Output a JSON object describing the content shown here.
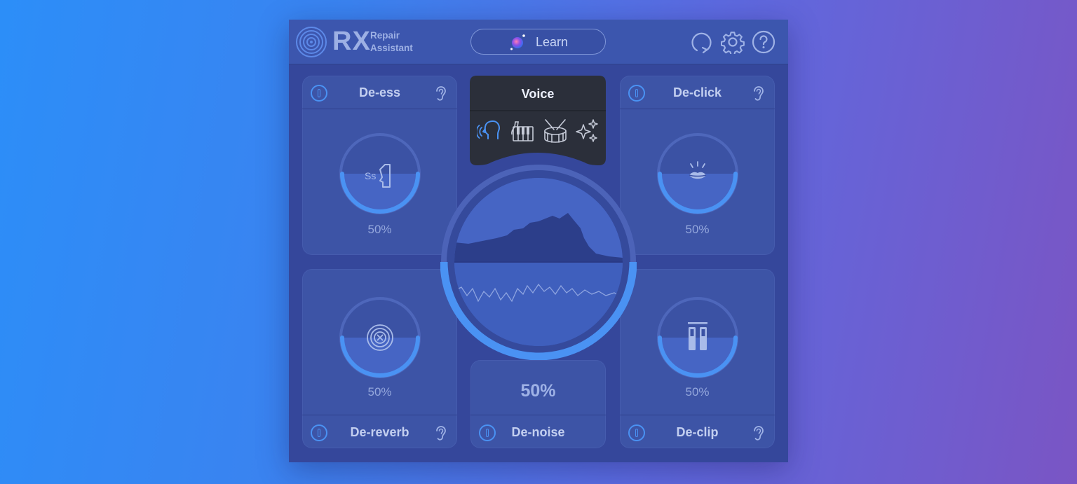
{
  "app": {
    "logo_main": "RX",
    "logo_sub_line1": "Repair",
    "logo_sub_line2": "Assistant",
    "learn_label": "Learn"
  },
  "icons": {
    "logo": "concentric-rings-icon",
    "learn": "orb-icon",
    "header": [
      "undo-icon",
      "gear-icon",
      "help-icon"
    ],
    "module_power": "power-icon",
    "monitor": "ear-icon"
  },
  "popup": {
    "title": "Voice",
    "options": [
      {
        "name": "voice",
        "icon": "head-voice-icon",
        "selected": true
      },
      {
        "name": "piano",
        "icon": "piano-icon",
        "selected": false
      },
      {
        "name": "drum",
        "icon": "drum-icon",
        "selected": false
      },
      {
        "name": "sparkle",
        "icon": "sparkle-icon",
        "selected": false
      }
    ]
  },
  "modules": {
    "deess": {
      "title": "De-ess",
      "value": "50%",
      "level": 0.5,
      "icon": "sibilance-icon"
    },
    "declick": {
      "title": "De-click",
      "value": "50%",
      "level": 0.5,
      "icon": "lips-icon"
    },
    "dereverb": {
      "title": "De-reverb",
      "value": "50%",
      "level": 0.5,
      "icon": "target-x-icon"
    },
    "declip": {
      "title": "De-clip",
      "value": "50%",
      "level": 0.5,
      "icon": "clip-bars-icon"
    },
    "denoise": {
      "title": "De-noise",
      "value": "50%",
      "level": 0.5,
      "icon": "spectrum-icon"
    }
  },
  "colors": {
    "accent": "#4a92f3",
    "panel": "#3d54a6",
    "window": "#35479b",
    "popup": "#2b2f3a",
    "text": "#c3cff0"
  }
}
